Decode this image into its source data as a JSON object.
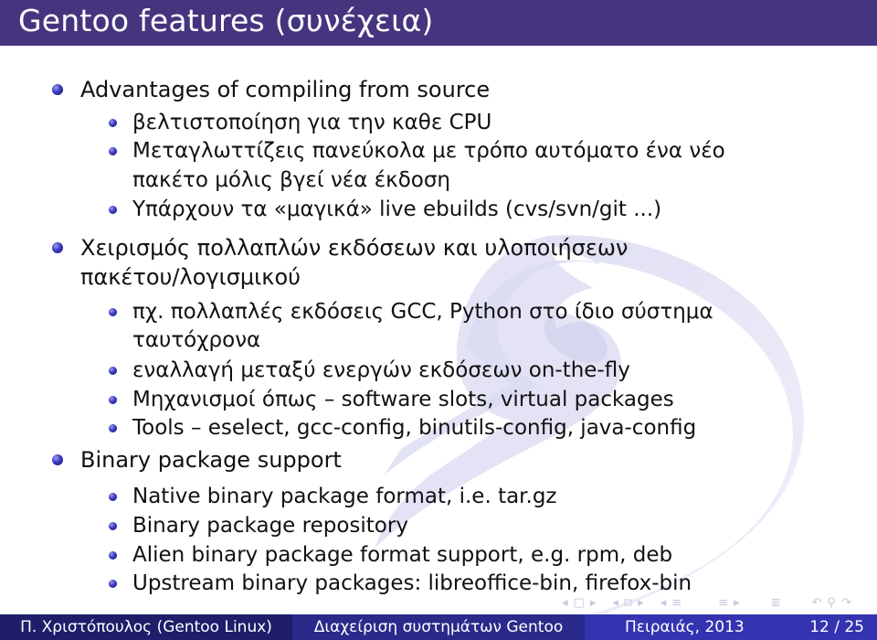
{
  "slide": {
    "title": "Gentoo features (συνέχεια)",
    "colors": {
      "title_bar": "#45357f",
      "footer_left": "#1e1e6b",
      "footer_middle": "#2a2a8a",
      "footer_right": "#3434b0",
      "bullet": "#3a3ac0",
      "watermark": "#dcdcf2"
    },
    "watermark_icon": "gentoo-logo-icon",
    "items": [
      {
        "text": "Advantages of compiling from source",
        "children": [
          {
            "text": "βελτιστοποίηση για την καθε CPU"
          },
          {
            "text": "Μεταγλωττίζεις πανεύκολα με τρόπο αυτόματο ένα νέο",
            "continuation": "πακέτο μόλις βγεί νέα έκδοση"
          },
          {
            "text": "Υπάρχουν τα «μαγικά» live ebuilds (cvs/svn/git ...)"
          }
        ]
      },
      {
        "text": "Χειρισμός πολλαπλών εκδόσεων και υλοποιήσεων",
        "continuation": "πακέτου/λογισμικού",
        "children": [
          {
            "text": "πχ. πολλαπλές εκδόσεις GCC, Python στο ίδιο σύστημα",
            "continuation": "ταυτόχρονα"
          },
          {
            "text": "εναλλαγή μεταξύ ενεργών εκδόσεων on-the-fly"
          },
          {
            "text": "Μηχανισμοί όπως – software slots, virtual packages"
          },
          {
            "text": "Tools – eselect, gcc-config, binutils-config, java-config"
          }
        ]
      },
      {
        "text": "Binary package support",
        "children": [
          {
            "text": "Native binary package format, i.e. tar.gz"
          },
          {
            "text": "Binary package repository"
          },
          {
            "text": "Alien binary package format support, e.g. rpm, deb"
          },
          {
            "text": "Upstream binary packages: libreoffice-bin, firefox-bin"
          }
        ]
      }
    ]
  },
  "navigation": {
    "icons": [
      {
        "name": "prev-frame-icon",
        "glyph": "◂"
      },
      {
        "name": "frame-icon",
        "glyph": "□"
      },
      {
        "name": "next-frame-icon",
        "glyph": "▸"
      },
      {
        "name": "prev-slide-icon",
        "glyph": "◂"
      },
      {
        "name": "slide-icon",
        "glyph": "⧉"
      },
      {
        "name": "next-slide-icon",
        "glyph": "▸"
      },
      {
        "name": "prev-section-icon",
        "glyph": "◂"
      },
      {
        "name": "section-icon",
        "glyph": "≡"
      },
      {
        "name": "subsection-icon",
        "glyph": "≡"
      },
      {
        "name": "next-section-icon",
        "glyph": "▸"
      },
      {
        "name": "toc-icon",
        "glyph": "≣"
      },
      {
        "name": "undo-icon",
        "glyph": "↶"
      },
      {
        "name": "search-icon",
        "glyph": "⚲"
      },
      {
        "name": "redo-icon",
        "glyph": "↷"
      }
    ]
  },
  "footer": {
    "author": "Π. Χριστόπουλος  (Gentoo Linux)",
    "presentation_title": "Διαχείριση συστημάτων Gentoo",
    "date": "Πειραιάς, 2013",
    "page": "12 / 25"
  }
}
